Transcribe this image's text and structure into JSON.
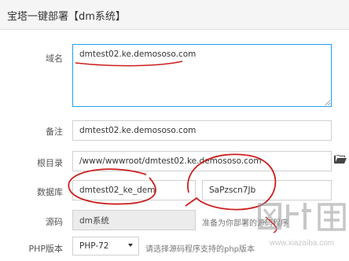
{
  "window": {
    "title": "宝塔一键部署【dm系统】"
  },
  "form": {
    "domain": {
      "label": "域名",
      "value": "dmtest02.ke.demososo.com"
    },
    "remark": {
      "label": "备注",
      "value": "dmtest02.ke.demososo.com"
    },
    "rootdir": {
      "label": "根目录",
      "value": "/www/wwwroot/dmtest02.ke.demososo.com"
    },
    "database": {
      "label": "数据库",
      "name_value": "dmtest02_ke_dem",
      "password_value": "SaPzscn7Jb"
    },
    "source": {
      "label": "源码",
      "value": "dm系统",
      "hint": "准备为你部署的源码程序"
    },
    "php": {
      "label": "PHP版本",
      "selected": "PHP-72",
      "hint": "请选择源码程序支持的php版本"
    }
  },
  "icons": {
    "folder": "folder-icon",
    "dropdown": "chevron-down-icon"
  },
  "watermark": {
    "brand": "下载吧",
    "domain": "www.xiazaiba.com"
  },
  "colors": {
    "annotation": "#cc1e1e",
    "focus_border": "#1e9ef5"
  }
}
